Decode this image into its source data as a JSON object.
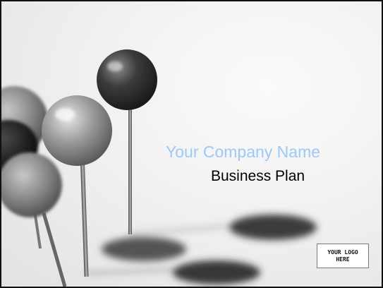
{
  "slide": {
    "company_name": "Your Company Name",
    "plan_title": "Business Plan",
    "logo_placeholder": "YOUR LOGO HERE"
  },
  "colors": {
    "company_name": "#9ec9f7",
    "plan_title": "#000000",
    "background": "#f1f1f1",
    "frame": "#111111"
  },
  "icons": [
    "push-pin-image"
  ]
}
